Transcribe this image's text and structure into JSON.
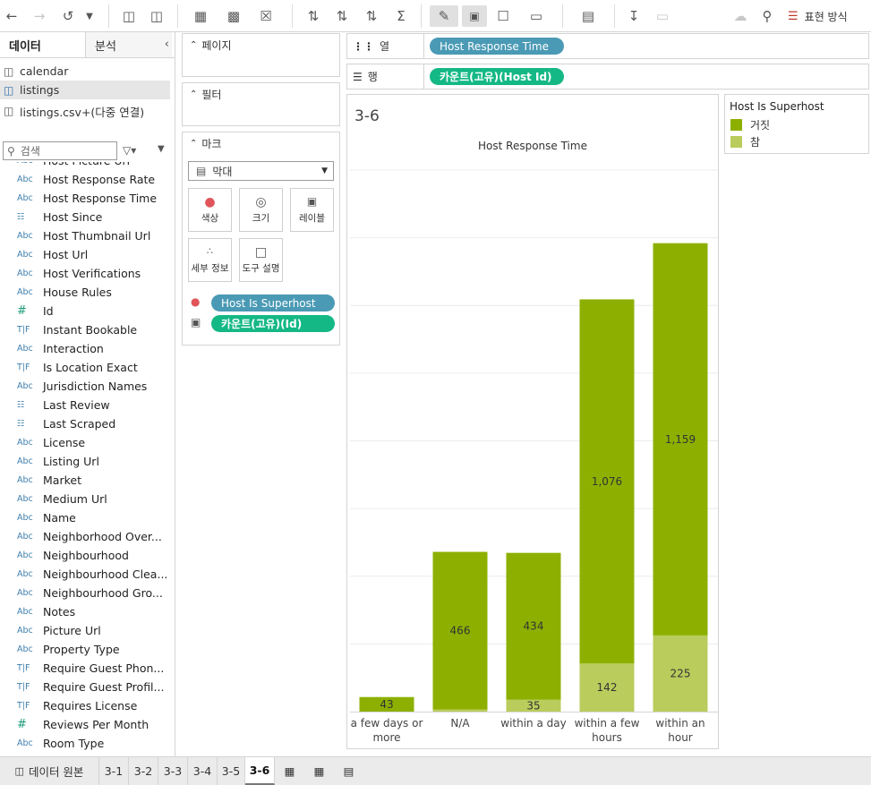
{
  "toolbar": {
    "show_me_label": "표현 방식"
  },
  "data_pane": {
    "tab_data": "데이터",
    "tab_analysis": "분석",
    "datasources": [
      {
        "name": "calendar"
      },
      {
        "name": "listings"
      },
      {
        "name": "listings.csv+(다중 연결)"
      }
    ],
    "search_placeholder": "검색",
    "fields": [
      {
        "type": "Abc",
        "name": "Host Picture Url"
      },
      {
        "type": "Abc",
        "name": "Host Response Rate"
      },
      {
        "type": "Abc",
        "name": "Host Response Time"
      },
      {
        "type": "date",
        "name": "Host Since"
      },
      {
        "type": "Abc",
        "name": "Host Thumbnail Url"
      },
      {
        "type": "Abc",
        "name": "Host Url"
      },
      {
        "type": "Abc",
        "name": "Host Verifications"
      },
      {
        "type": "Abc",
        "name": "House Rules"
      },
      {
        "type": "#",
        "name": "Id"
      },
      {
        "type": "T|F",
        "name": "Instant Bookable"
      },
      {
        "type": "Abc",
        "name": "Interaction"
      },
      {
        "type": "T|F",
        "name": "Is Location Exact"
      },
      {
        "type": "Abc",
        "name": "Jurisdiction Names"
      },
      {
        "type": "date",
        "name": "Last Review"
      },
      {
        "type": "date",
        "name": "Last Scraped"
      },
      {
        "type": "Abc",
        "name": "License"
      },
      {
        "type": "Abc",
        "name": "Listing Url"
      },
      {
        "type": "Abc",
        "name": "Market"
      },
      {
        "type": "Abc",
        "name": "Medium Url"
      },
      {
        "type": "Abc",
        "name": "Name"
      },
      {
        "type": "Abc",
        "name": "Neighborhood Over..."
      },
      {
        "type": "Abc",
        "name": "Neighbourhood"
      },
      {
        "type": "Abc",
        "name": "Neighbourhood Clea..."
      },
      {
        "type": "Abc",
        "name": "Neighbourhood Gro..."
      },
      {
        "type": "Abc",
        "name": "Notes"
      },
      {
        "type": "Abc",
        "name": "Picture Url"
      },
      {
        "type": "Abc",
        "name": "Property Type"
      },
      {
        "type": "T|F",
        "name": "Require Guest Phon..."
      },
      {
        "type": "T|F",
        "name": "Require Guest Profil..."
      },
      {
        "type": "T|F",
        "name": "Requires License"
      },
      {
        "type": "#",
        "name": "Reviews Per Month"
      },
      {
        "type": "Abc",
        "name": "Room Type"
      }
    ]
  },
  "cards": {
    "pages": "페이지",
    "filters": "필터",
    "marks": "마크",
    "mark_type": "막대",
    "buttons": {
      "color": "색상",
      "size": "크기",
      "label": "레이블",
      "detail": "세부 정보",
      "tooltip": "도구 설명"
    },
    "mark_pills": {
      "color_field": "Host Is Superhost",
      "label_field": "카운트(고유)(Id)"
    }
  },
  "shelves": {
    "columns_label": "열",
    "columns_pill": "Host Response Time",
    "rows_label": "행",
    "rows_pill": "카운트(고유)(Host Id)"
  },
  "sheet": {
    "title": "3-6"
  },
  "legend": {
    "title": "Host Is Superhost",
    "items": [
      {
        "label": "거짓",
        "color": "#8db000"
      },
      {
        "label": "참",
        "color": "#b9cc5c"
      }
    ]
  },
  "chart_data": {
    "type": "bar",
    "stacked": true,
    "title": "Host Response Time",
    "categories": [
      "a few days or more",
      "N/A",
      "within a day",
      "within a few hours",
      "within an hour"
    ],
    "category_lines": [
      [
        "a few days or",
        "more"
      ],
      [
        "N/A"
      ],
      [
        "within a day"
      ],
      [
        "within a few",
        "hours"
      ],
      [
        "within an",
        "hour"
      ]
    ],
    "series": [
      {
        "name": "참",
        "color": "#b9cc5c",
        "values": [
          0,
          6,
          35,
          142,
          225
        ],
        "labels": [
          "",
          "",
          "35",
          "142",
          "225"
        ]
      },
      {
        "name": "거짓",
        "color": "#8db000",
        "values": [
          43,
          466,
          434,
          1076,
          1159
        ],
        "labels": [
          "43",
          "466",
          "434",
          "1,076",
          "1,159"
        ]
      }
    ],
    "ylim": [
      0,
      1600
    ],
    "gridlines": [
      200,
      400,
      600,
      800,
      1000,
      1200,
      1400,
      1600
    ]
  },
  "bottom_tabs": {
    "datasource_tab": "데이터 원본",
    "sheets": [
      "3-1",
      "3-2",
      "3-3",
      "3-4",
      "3-5",
      "3-6"
    ],
    "active": "3-6"
  }
}
